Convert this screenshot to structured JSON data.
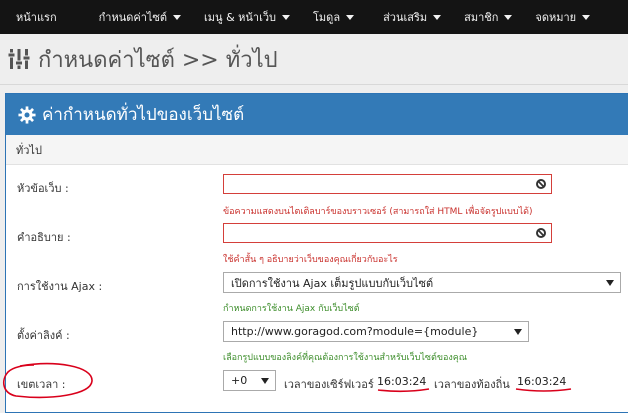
{
  "nav": {
    "items": [
      {
        "label": "หน้าแรก",
        "dropdown": false
      },
      {
        "label": "กำหนดค่าไซต์",
        "dropdown": true
      },
      {
        "label": "เมนู & หน้าเว็บ",
        "dropdown": true
      },
      {
        "label": "โมดูล",
        "dropdown": true
      },
      {
        "label": "ส่วนเสริม",
        "dropdown": true
      },
      {
        "label": "สมาชิก",
        "dropdown": true
      },
      {
        "label": "จดหมาย",
        "dropdown": true
      }
    ]
  },
  "header": {
    "icon": "sliders-icon",
    "title": "กำหนดค่าไซต์ >> ทั่วไป"
  },
  "panel": {
    "icon": "gear-icon",
    "heading": "ค่ากำหนดทั่วไปของเว็บไซต์",
    "section": "ทั่วไป"
  },
  "form": {
    "web_title": {
      "label": "หัวข้อเว็บ :",
      "value": "",
      "help": "ข้อความแสดงบนไตเติลบาร์ของบราวเซอร์ (สามารถใส่ HTML เพื่อจัดรูปแบบได้)"
    },
    "description": {
      "label": "คำอธิบาย :",
      "value": "",
      "help": "ใช้คำสั้น ๆ อธิบายว่าเว็บของคุณเกี่ยวกับอะไร"
    },
    "ajax": {
      "label": "การใช้งาน Ajax :",
      "selected": "เปิดการใช้งาน Ajax เต็มรูปแบบกับเว็บไซต์",
      "help": "กำหนดการใช้งาน Ajax กับเว็บไซต์"
    },
    "link": {
      "label": "ตั้งค่าลิงค์ :",
      "selected": "http://www.goragod.com?module={module}",
      "help": "เลือกรูปแบบของลิงค์ที่คุณต้องการใช้งานสำหรับเว็บไซต์ของคุณ"
    },
    "timezone": {
      "label": "เขตเวลา :",
      "selected": "+0",
      "server_time_label": "เวลาของเซิร์ฟเวอร์",
      "server_time": "16:03:24",
      "local_time_label": "เวลาของท้องถิ่น",
      "local_time": "16:03:24"
    }
  },
  "colors": {
    "navbar": "#141414",
    "panel_heading": "#337ab7",
    "error": "#c9302c",
    "success": "#3c8d2a",
    "annotation": "#d9001b"
  }
}
